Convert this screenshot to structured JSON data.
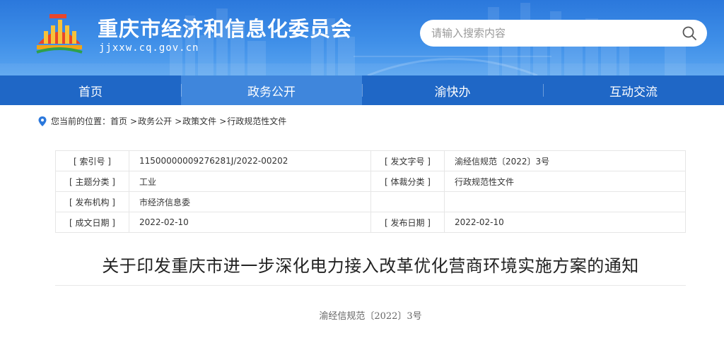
{
  "header": {
    "site_title": "重庆市经济和信息化委员会",
    "site_domain": "jjxxw.cq.gov.cn",
    "search_placeholder": "请输入搜索内容",
    "brand_color": "#2b78dc"
  },
  "nav": {
    "items": [
      {
        "label": "首页"
      },
      {
        "label": "政务公开"
      },
      {
        "label": "渝快办"
      },
      {
        "label": "互动交流"
      }
    ],
    "active_index": 1
  },
  "breadcrumb": {
    "prefix": "您当前的位置：",
    "items": [
      "首页",
      "政务公开",
      "政策文件",
      "行政规范性文件"
    ],
    "separator": ">"
  },
  "meta": {
    "rows": [
      {
        "l1": "[ 索引号 ]",
        "v1": "11500000009276281J/2022-00202",
        "l2": "[ 发文字号 ]",
        "v2": "渝经信规范〔2022〕3号"
      },
      {
        "l1": "[ 主题分类 ]",
        "v1": "工业",
        "l2": "[ 体裁分类 ]",
        "v2": "行政规范性文件"
      },
      {
        "l1": "[ 发布机构 ]",
        "v1": "市经济信息委",
        "l2": "",
        "v2": ""
      },
      {
        "l1": "[ 成文日期 ]",
        "v1": "2022-02-10",
        "l2": "[ 发布日期 ]",
        "v2": "2022-02-10"
      }
    ]
  },
  "document": {
    "title": "关于印发重庆市进一步深化电力接入改革优化营商环境实施方案的通知",
    "number": "渝经信规范〔2022〕3号"
  }
}
